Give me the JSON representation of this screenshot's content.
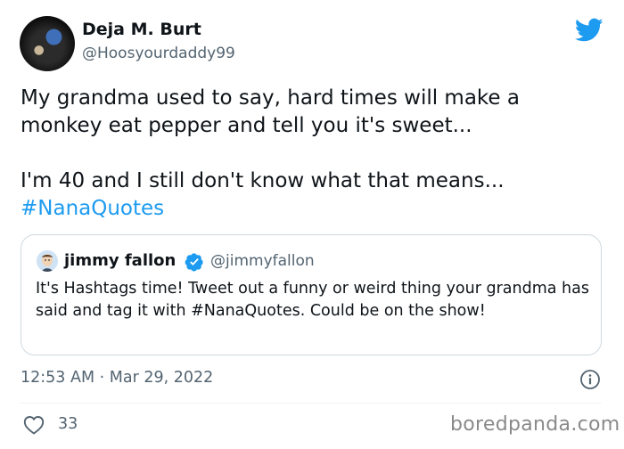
{
  "author": {
    "display_name": "Deja M. Burt",
    "handle": "@Hoosyourdaddy99"
  },
  "tweet": {
    "line1": "My grandma used to say, hard times will make a",
    "line2": "monkey eat pepper and tell you it's sweet...",
    "line3": "I'm 40 and I still don't know what that means...",
    "hashtag": "#NanaQuotes",
    "timestamp": "12:53 AM · Mar 29, 2022",
    "likes": "33"
  },
  "quoted": {
    "display_name": "jimmy fallon",
    "handle": "@jimmyfallon",
    "text": "It's Hashtags time! Tweet out a funny or weird thing your grandma has said and tag it with #NanaQuotes. Could be on the show!"
  },
  "watermark": "boredpanda.com",
  "colors": {
    "accent": "#1d9bf0",
    "secondary_text": "#536471"
  },
  "icons": [
    "twitter-bird-icon",
    "verified-badge-icon",
    "info-icon",
    "heart-icon"
  ]
}
